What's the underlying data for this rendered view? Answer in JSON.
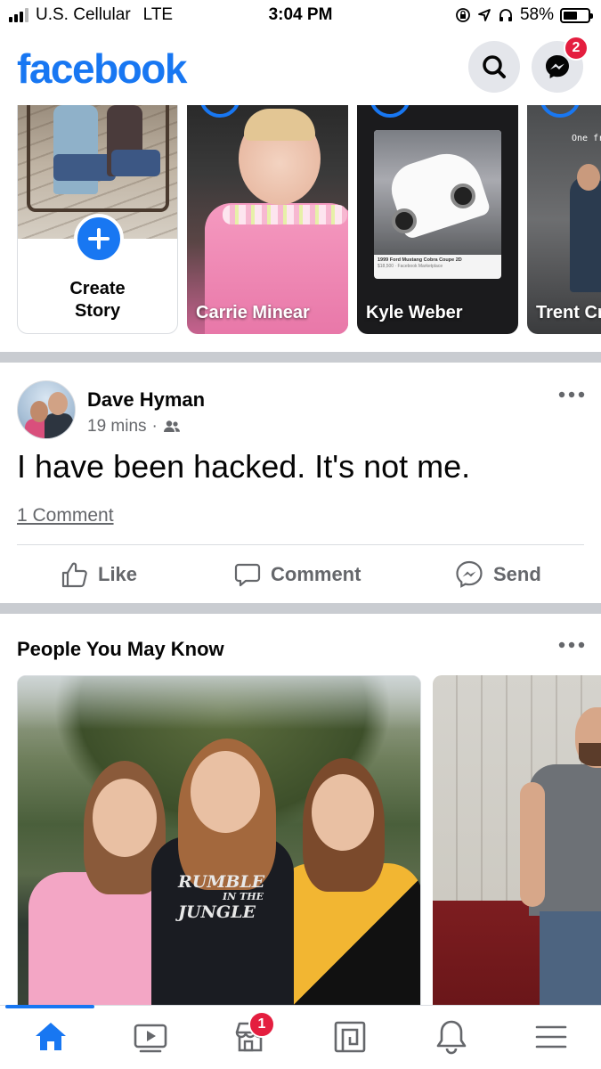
{
  "status_bar": {
    "carrier": "U.S. Cellular",
    "network": "LTE",
    "time": "3:04 PM",
    "battery": "58%",
    "battery_level": 0.58,
    "icons": [
      "lock-rotation-icon",
      "location-icon",
      "headphones-icon",
      "battery-icon"
    ]
  },
  "header": {
    "logo": "facebook",
    "brand_color": "#1877f2",
    "messenger_badge": "2",
    "icons": [
      "search-icon",
      "messenger-icon"
    ]
  },
  "stories": {
    "create_label": "Create Story",
    "items": [
      {
        "name": "Carrie Minear"
      },
      {
        "name": "Kyle Weber",
        "card_title": "1999 Ford Mustang Cobra Coupe 2D",
        "card_subtitle": "$18,500 · Facebook Marketplace"
      },
      {
        "name": "Trent Cr",
        "overlay_text": "One fr"
      }
    ]
  },
  "post": {
    "author": "Dave Hyman",
    "time": "19 mins",
    "separator": "·",
    "audience_icon": "friends-icon",
    "text": "I have been hacked.  It's not me.",
    "comments": "1 Comment",
    "actions": {
      "like": "Like",
      "comment": "Comment",
      "send": "Send"
    }
  },
  "pymk": {
    "title": "People You May Know",
    "shirt_text_1": "RUMBLE",
    "shirt_text_2": "IN THE",
    "shirt_text_3": "JUNGLE"
  },
  "tabbar": {
    "active": "home",
    "marketplace_badge": "1",
    "tabs": [
      "home-icon",
      "watch-icon",
      "marketplace-icon",
      "pages-icon",
      "notifications-icon",
      "menu-icon"
    ]
  }
}
